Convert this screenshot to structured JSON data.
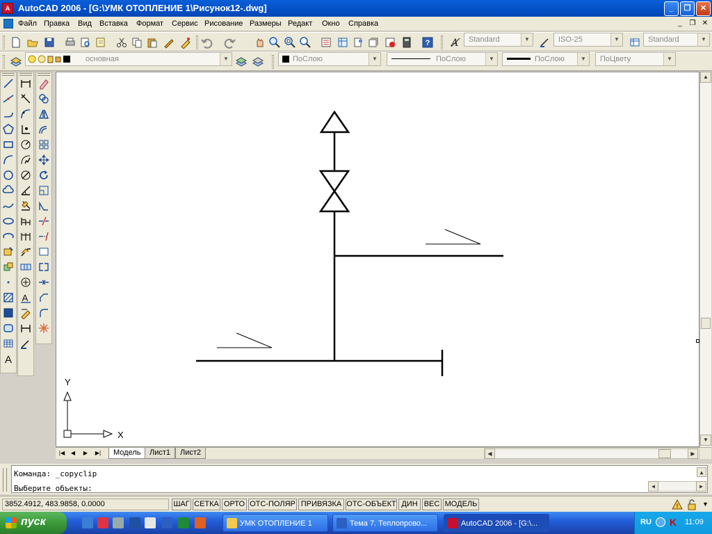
{
  "window": {
    "title": "AutoCAD 2006 - [G:\\УМК ОТОПЛЕНИЕ 1\\Рисунок12-.dwg]",
    "app_icon_label": "A"
  },
  "menu": {
    "items": [
      "Файл",
      "Правка",
      "Вид",
      "Вставка",
      "Формат",
      "Сервис",
      "Рисование",
      "Размеры",
      "Редакт",
      "Окно",
      "Справка"
    ]
  },
  "toolbar": {
    "text_style": "Standard",
    "dim_style": "ISO-25",
    "table_style": "Standard",
    "layer": "основная",
    "color": "ПоСлою",
    "linetype": "ПоСлою",
    "lineweight": "ПоСлою",
    "plot_style": "ПоЦвету"
  },
  "ucs": {
    "y_label": "Y",
    "x_label": "X"
  },
  "tabs": [
    "Модель",
    "Лист1",
    "Лист2"
  ],
  "command": {
    "history": "Команда:  _copyclip",
    "prompt": "Выберите объекты:"
  },
  "status": {
    "coordinates": "3852.4912, 483.9858, 0.0000",
    "toggles": [
      "ШАГ",
      "СЕТКА",
      "ОРТО",
      "ОТС-ПОЛЯР",
      "ПРИВЯЗКА",
      "ОТС-ОБЪЕКТ",
      "ДИН",
      "ВЕС",
      "МОДЕЛЬ"
    ]
  },
  "taskbar": {
    "start_label": "пуск",
    "tasks": [
      "УМК ОТОПЛЕНИЕ 1",
      "Тема 7. Теплопрово...",
      "AutoCAD 2006 - [G:\\..."
    ],
    "language": "RU",
    "clock": "11:09"
  }
}
